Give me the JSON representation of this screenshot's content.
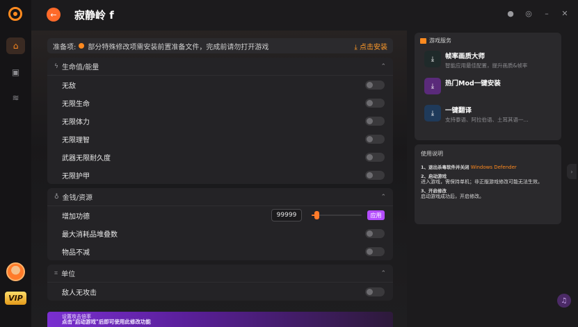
{
  "app": {
    "title": "寂静岭 f"
  },
  "rail": {
    "vip_label": "VIP"
  },
  "prep": {
    "label": "准备项:",
    "text": "部分特殊修改项需安装前置准备文件，完成前请勿打开游戏",
    "install_label": "点击安装"
  },
  "sections": {
    "health": {
      "title": "生命值/能量",
      "items": [
        "无敌",
        "无限生命",
        "无限体力",
        "无限理智",
        "武器无限耐久度",
        "无限护甲"
      ]
    },
    "money": {
      "title": "金钱/资源",
      "add_merit_label": "增加功德",
      "add_merit_value": "99999",
      "add_merit_slider_fraction": 0.1,
      "apply_label": "应用",
      "items": [
        "最大消耗品堆叠数",
        "物品不减"
      ]
    },
    "unit": {
      "title": "单位",
      "items": [
        "敌人无攻击"
      ]
    }
  },
  "promo": {
    "line1": "设置攻击倍率",
    "line2": "点击\"启动游戏\"后即可使用此修改功能"
  },
  "services": {
    "title": "游戏服务",
    "items": [
      {
        "name": "帧率画质大师",
        "desc": "智能应用最佳配置，提升画质&帧率"
      },
      {
        "name": "热门Mod一键安装",
        "desc": ""
      },
      {
        "name": "一键翻译",
        "desc": "支持泰语、阿拉伯语、土耳其语一..."
      }
    ]
  },
  "usage": {
    "title": "使用说明",
    "step1_label": "1、退出杀毒软件并关闭",
    "step1_highlight": "Windows Defender",
    "step2_label": "2、启动游戏",
    "step2_text": "进入游戏，需保持单机；非正版游戏修改可能无法生效。",
    "step3_label": "3、开启修改",
    "step3_text": "启动游戏成功后，开启修改。"
  },
  "colors": {
    "accent": "#ff8a1f",
    "apply": "#b44dff",
    "background": "#1c1b1d"
  }
}
